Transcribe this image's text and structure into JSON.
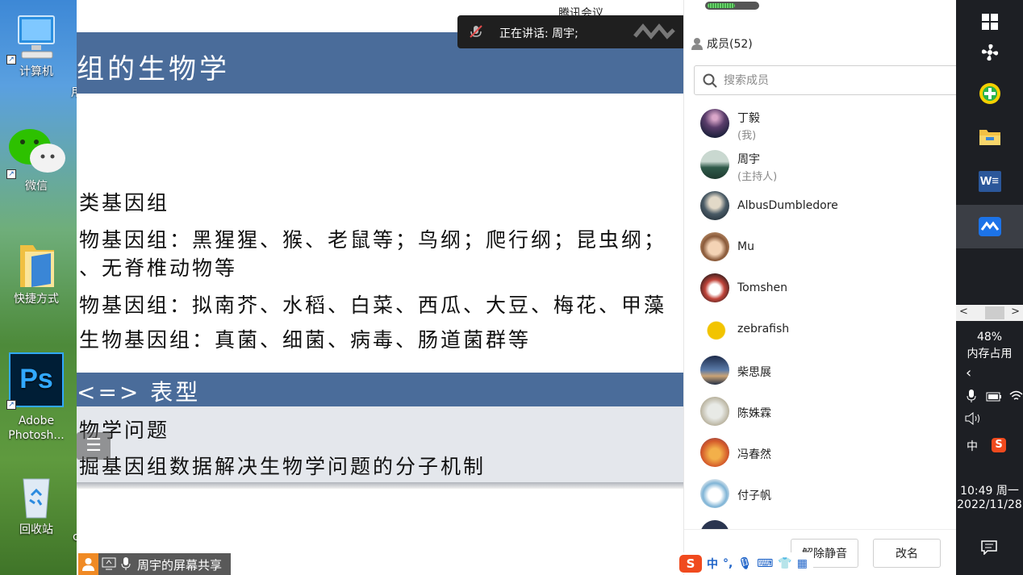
{
  "desktop": {
    "icons": [
      {
        "label": "计算机",
        "icon": "computer-icon"
      },
      {
        "label": "微信",
        "icon": "wechat-icon"
      },
      {
        "label": "快捷方式",
        "icon": "folder-shortcut-icon"
      },
      {
        "label": "Adobe Photosh...",
        "icon": "photoshop-icon"
      },
      {
        "label": "回收站",
        "icon": "recycle-bin-icon"
      }
    ],
    "clipped_char_1": "用",
    "clipped_char_2": "c"
  },
  "window": {
    "title": "腾讯会议"
  },
  "speaker_toast": {
    "text": "正在讲话: 周宇;"
  },
  "slide": {
    "title": "组的生物学",
    "lines": [
      "类基因组",
      "物基因组：黑猩猩、猴、老鼠等；鸟纲；爬行纲；昆虫纲；",
      "、无脊椎动物等",
      "物基因组：拟南芥、水稻、白菜、西瓜、大豆、梅花、甲藻",
      "生物基因组：真菌、细菌、病毒、肠道菌群等"
    ],
    "section_title": "<=> 表型",
    "section_lines": [
      "物学问题",
      "掘基因组数据解决生物学问题的分子机制"
    ]
  },
  "members_panel": {
    "header": "成员(52)",
    "search_placeholder": "搜索成员",
    "members": [
      {
        "name": "丁毅",
        "role": "(我)"
      },
      {
        "name": "周宇",
        "role": "(主持人)"
      },
      {
        "name": "AlbusDumbledore",
        "role": ""
      },
      {
        "name": "Mu",
        "role": ""
      },
      {
        "name": "Tomshen",
        "role": ""
      },
      {
        "name": "zebrafish",
        "role": ""
      },
      {
        "name": "柴思展",
        "role": ""
      },
      {
        "name": "陈姝霖",
        "role": ""
      },
      {
        "name": "冯春然",
        "role": ""
      },
      {
        "name": "付子帆",
        "role": ""
      }
    ],
    "unmute_button": "解除静音",
    "rename_button": "改名",
    "signal_level": 0.55
  },
  "taskbar": {
    "memory_percent": "48%",
    "memory_label": "内存占用",
    "ime_indicator": "中",
    "time": "10:49 周一",
    "date": "2022/11/28",
    "icons": [
      "windows-start-icon",
      "fan-icon",
      "add-app-icon",
      "file-explorer-icon",
      "word-icon",
      "tencent-meeting-icon"
    ]
  },
  "share_bar": {
    "text": "周宇的屏幕共享"
  },
  "ime_bar": {
    "lang": "中"
  }
}
